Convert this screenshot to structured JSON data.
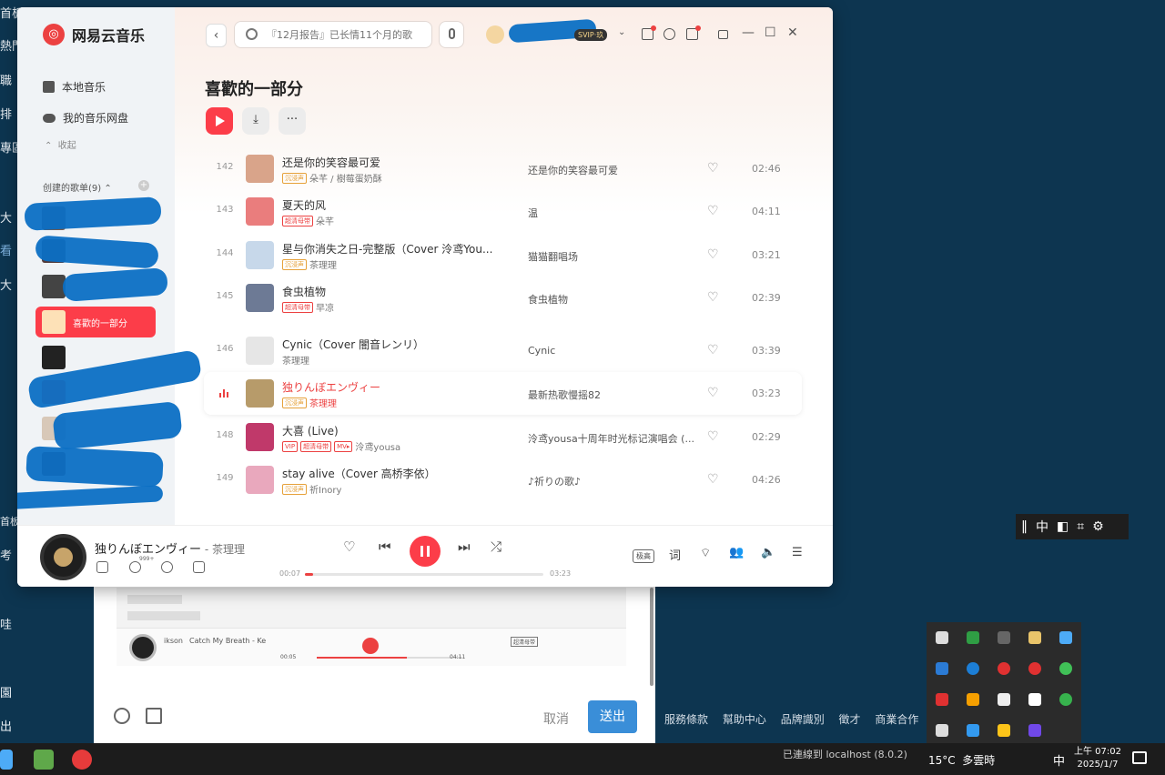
{
  "desktop": {
    "left_labels": [
      "首板",
      "熱門",
      "職",
      "排",
      "專區",
      "大",
      "看",
      "大",
      "首板",
      "考",
      "哇",
      "園",
      "出"
    ]
  },
  "background_page": {
    "mini_player": {
      "prefix": "ikson",
      "song": "Catch My Breath - Ke",
      "quality": "超清母带",
      "time_current": "00:05",
      "time_total": "04:11"
    },
    "cancel": "取消",
    "send": "送出"
  },
  "footer_links": [
    "服務條款",
    "幫助中心",
    "品牌識別",
    "徵才",
    "商業合作"
  ],
  "ime_bar": {
    "lang": "中"
  },
  "taskbar": {
    "server_status": "已連線到 localhost (8.0.2)",
    "weather_temp": "15°C",
    "weather_desc": "多雲時",
    "ime": "中",
    "time": "上午 07:02",
    "date": "2025/1/7"
  },
  "app": {
    "brand": {
      "logo_glyph": "◎",
      "name": "网易云音乐"
    },
    "search": {
      "placeholder": "『12月报告』已长情11个月的歌"
    },
    "account": {
      "vip_badge": "SVIP·玖"
    },
    "sidebar": {
      "local_music": "本地音乐",
      "cloud_disk": "我的音乐网盘",
      "collapse": "收起",
      "created_playlists": "创建的歌单(9)",
      "active_playlist": "喜歡的一部分"
    },
    "playlist": {
      "title": "喜歡的一部分",
      "more": "···"
    },
    "tracks": [
      {
        "num": "142",
        "name": "还是你的笑容最可爱",
        "badges": [
          "沉浸声"
        ],
        "artist": "朵芊 / 樹莓蛋奶酥",
        "album": "还是你的笑容最可爱",
        "duration": "02:46",
        "cover": "#d9a48a"
      },
      {
        "num": "143",
        "name": "夏天的风",
        "badges": [
          "超清母带"
        ],
        "artist": "朵芊",
        "album": "温",
        "duration": "04:11",
        "cover": "#ea7d7d"
      },
      {
        "num": "144",
        "name": "星与你消失之日-完整版（Cover 泠鸢You...",
        "badges": [
          "沉浸声"
        ],
        "artist": "茶理理",
        "album": "猫猫翻唱场",
        "duration": "03:21",
        "cover": "#c7d8ea"
      },
      {
        "num": "145",
        "name": "食虫植物",
        "badges": [
          "超清母带"
        ],
        "artist": "早凉",
        "album": "食虫植物",
        "duration": "02:39",
        "cover": "#6d7a95"
      },
      {
        "num": "146",
        "name": "Cynic（Cover 闇音レンリ）",
        "badges": [],
        "artist": "茶理理",
        "album": "Cynic",
        "duration": "03:39",
        "cover": "#e6e6e6"
      },
      {
        "num": "147",
        "name": "独りんぼエンヴィー",
        "badges": [
          "沉浸声"
        ],
        "artist": "茶理理",
        "album": "最新热歌慢摇82",
        "duration": "03:23",
        "cover": "#b79b6a"
      },
      {
        "num": "148",
        "name": "大喜 (Live)",
        "badges": [
          "VIP",
          "超清母带",
          "MV▸"
        ],
        "artist": "泠鸢yousa",
        "album": "泠鸢yousa十周年时光标记演唱会 (...",
        "duration": "02:29",
        "cover": "#c0396a"
      },
      {
        "num": "149",
        "name": "stay alive（Cover 高桥李依）",
        "badges": [
          "沉浸声"
        ],
        "artist": "祈Inory",
        "album": "♪祈りの歌♪",
        "duration": "04:26",
        "cover": "#e9a8bd"
      }
    ],
    "now_playing": {
      "title": "独りんぼエンヴィー",
      "sep": " - ",
      "artist": "茶理理",
      "comment_count": "999+",
      "time_current": "00:07",
      "time_total": "03:23",
      "progress": 0.034,
      "quality": "极高",
      "lyrics": "词"
    }
  }
}
